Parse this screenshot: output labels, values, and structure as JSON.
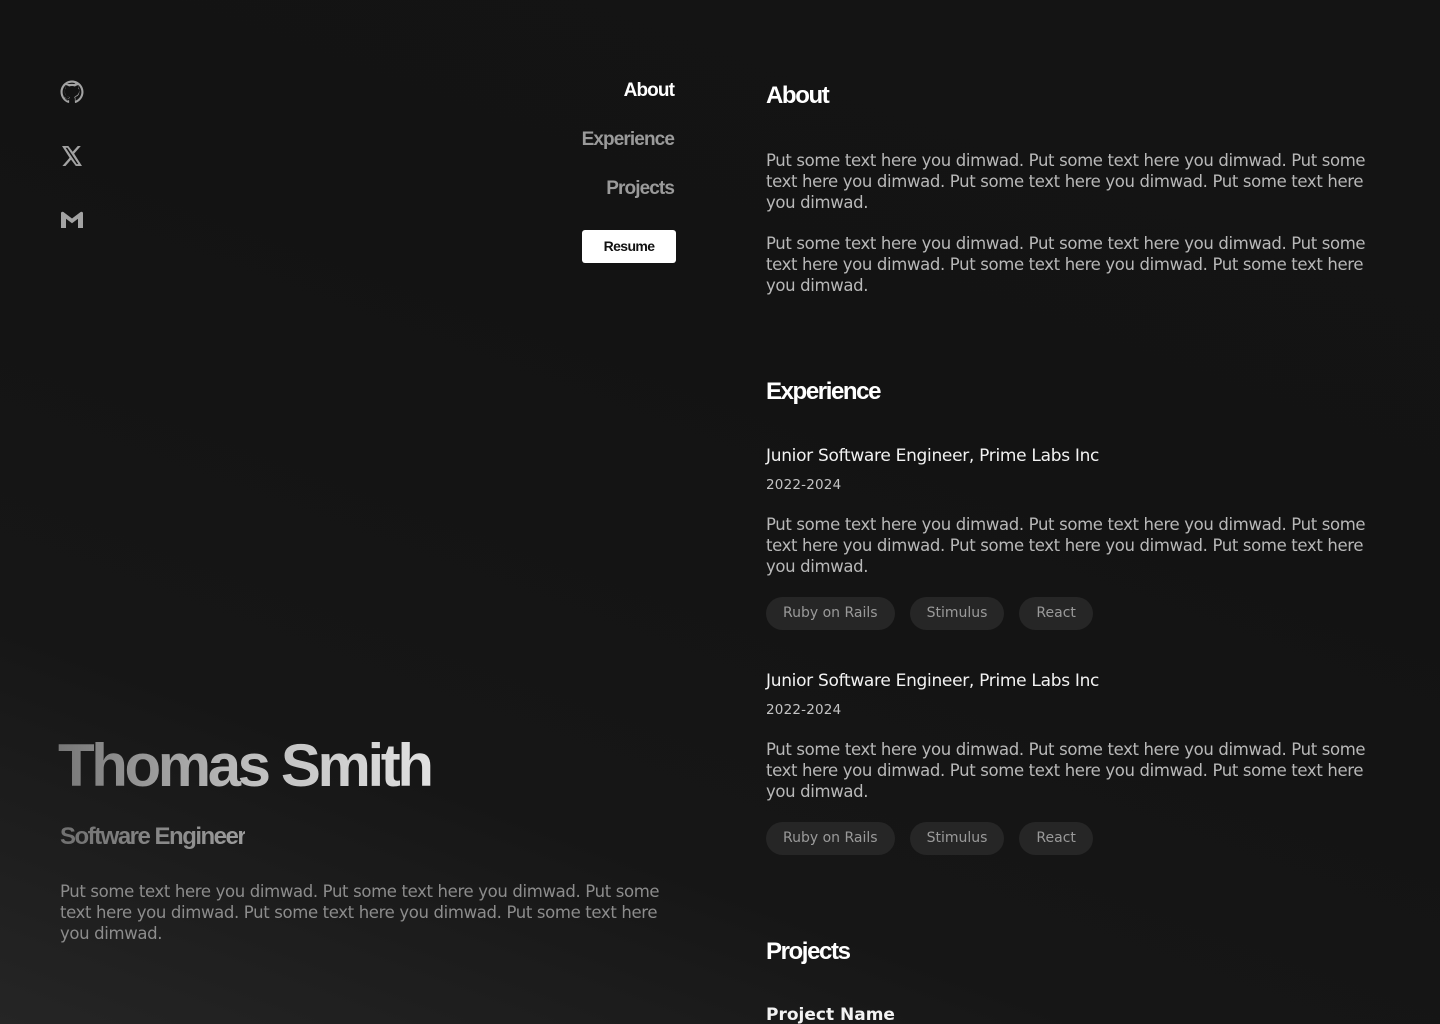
{
  "socials": [
    {
      "icon": "github-icon"
    },
    {
      "icon": "x-twitter-icon"
    },
    {
      "icon": "gmail-icon"
    }
  ],
  "nav": {
    "items": [
      "About",
      "Experience",
      "Projects"
    ],
    "active": "About",
    "resume_label": "Resume"
  },
  "hero": {
    "name": "Thomas Smith",
    "role": "Software Engineer",
    "bio": "Put some text here you dimwad. Put some text here you dimwad. Put some text here you dimwad. Put some text here you dimwad. Put some text here you dimwad."
  },
  "about": {
    "heading": "About",
    "paragraphs": [
      "Put some text here you dimwad. Put some text here you dimwad. Put some text here you dimwad. Put some text here you dimwad. Put some text here you dimwad.",
      "Put some text here you dimwad. Put some text here you dimwad. Put some text here you dimwad. Put some text here you dimwad. Put some text here you dimwad."
    ]
  },
  "experience": {
    "heading": "Experience",
    "jobs": [
      {
        "title": "Junior Software Engineer, Prime Labs Inc",
        "dates": "2022-2024",
        "description": "Put some text here you dimwad. Put some text here you dimwad. Put some text here you dimwad. Put some text here you dimwad. Put some text here you dimwad.",
        "tags": [
          "Ruby on Rails",
          "Stimulus",
          "React"
        ]
      },
      {
        "title": "Junior Software Engineer, Prime Labs Inc",
        "dates": "2022-2024",
        "description": "Put some text here you dimwad. Put some text here you dimwad. Put some text here you dimwad. Put some text here you dimwad. Put some text here you dimwad.",
        "tags": [
          "Ruby on Rails",
          "Stimulus",
          "React"
        ]
      }
    ]
  },
  "projects": {
    "heading": "Projects",
    "items": [
      {
        "name": "Project Name"
      }
    ]
  }
}
